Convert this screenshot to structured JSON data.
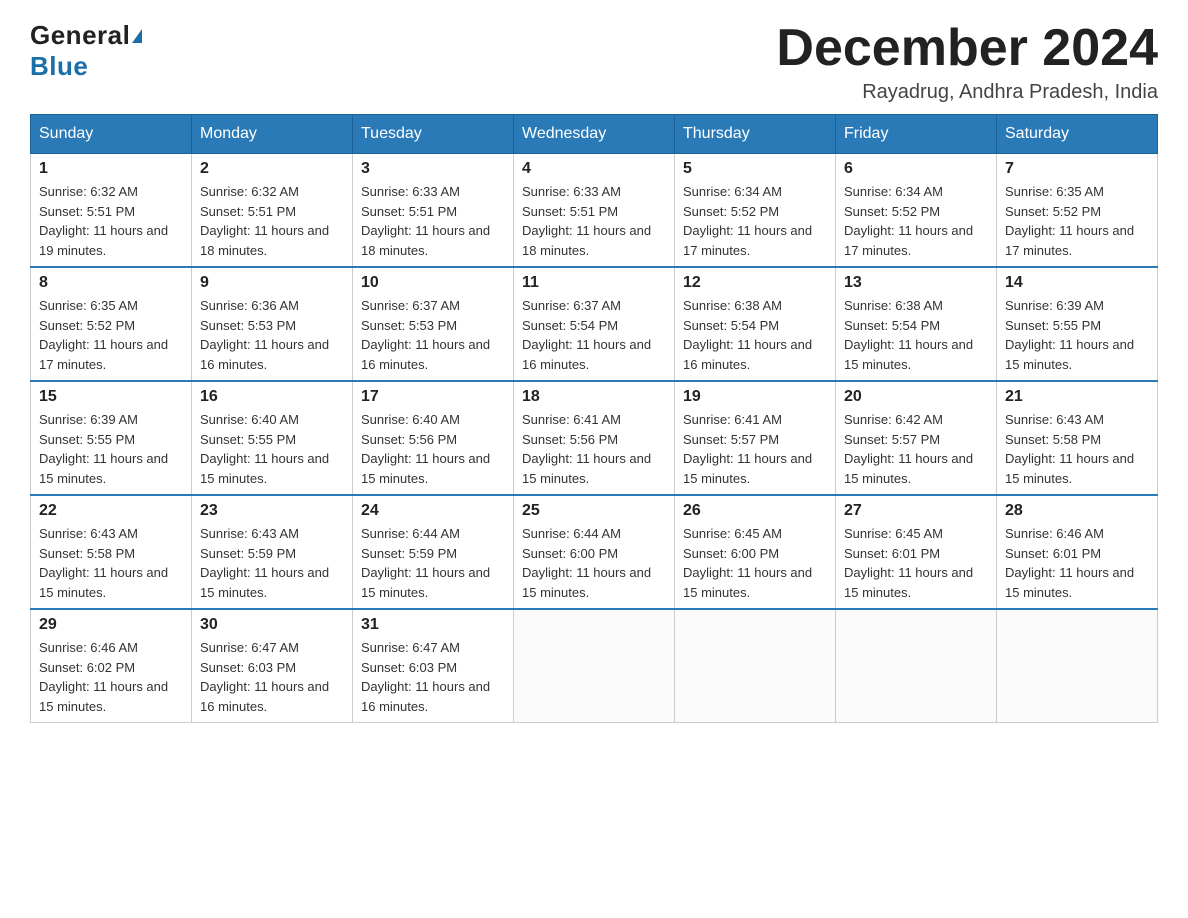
{
  "header": {
    "logo_general": "General",
    "logo_blue": "Blue",
    "title": "December 2024",
    "subtitle": "Rayadrug, Andhra Pradesh, India"
  },
  "weekdays": [
    "Sunday",
    "Monday",
    "Tuesday",
    "Wednesday",
    "Thursday",
    "Friday",
    "Saturday"
  ],
  "weeks": [
    [
      {
        "day": "1",
        "sunrise": "6:32 AM",
        "sunset": "5:51 PM",
        "daylight": "11 hours and 19 minutes."
      },
      {
        "day": "2",
        "sunrise": "6:32 AM",
        "sunset": "5:51 PM",
        "daylight": "11 hours and 18 minutes."
      },
      {
        "day": "3",
        "sunrise": "6:33 AM",
        "sunset": "5:51 PM",
        "daylight": "11 hours and 18 minutes."
      },
      {
        "day": "4",
        "sunrise": "6:33 AM",
        "sunset": "5:51 PM",
        "daylight": "11 hours and 18 minutes."
      },
      {
        "day": "5",
        "sunrise": "6:34 AM",
        "sunset": "5:52 PM",
        "daylight": "11 hours and 17 minutes."
      },
      {
        "day": "6",
        "sunrise": "6:34 AM",
        "sunset": "5:52 PM",
        "daylight": "11 hours and 17 minutes."
      },
      {
        "day": "7",
        "sunrise": "6:35 AM",
        "sunset": "5:52 PM",
        "daylight": "11 hours and 17 minutes."
      }
    ],
    [
      {
        "day": "8",
        "sunrise": "6:35 AM",
        "sunset": "5:52 PM",
        "daylight": "11 hours and 17 minutes."
      },
      {
        "day": "9",
        "sunrise": "6:36 AM",
        "sunset": "5:53 PM",
        "daylight": "11 hours and 16 minutes."
      },
      {
        "day": "10",
        "sunrise": "6:37 AM",
        "sunset": "5:53 PM",
        "daylight": "11 hours and 16 minutes."
      },
      {
        "day": "11",
        "sunrise": "6:37 AM",
        "sunset": "5:54 PM",
        "daylight": "11 hours and 16 minutes."
      },
      {
        "day": "12",
        "sunrise": "6:38 AM",
        "sunset": "5:54 PM",
        "daylight": "11 hours and 16 minutes."
      },
      {
        "day": "13",
        "sunrise": "6:38 AM",
        "sunset": "5:54 PM",
        "daylight": "11 hours and 15 minutes."
      },
      {
        "day": "14",
        "sunrise": "6:39 AM",
        "sunset": "5:55 PM",
        "daylight": "11 hours and 15 minutes."
      }
    ],
    [
      {
        "day": "15",
        "sunrise": "6:39 AM",
        "sunset": "5:55 PM",
        "daylight": "11 hours and 15 minutes."
      },
      {
        "day": "16",
        "sunrise": "6:40 AM",
        "sunset": "5:55 PM",
        "daylight": "11 hours and 15 minutes."
      },
      {
        "day": "17",
        "sunrise": "6:40 AM",
        "sunset": "5:56 PM",
        "daylight": "11 hours and 15 minutes."
      },
      {
        "day": "18",
        "sunrise": "6:41 AM",
        "sunset": "5:56 PM",
        "daylight": "11 hours and 15 minutes."
      },
      {
        "day": "19",
        "sunrise": "6:41 AM",
        "sunset": "5:57 PM",
        "daylight": "11 hours and 15 minutes."
      },
      {
        "day": "20",
        "sunrise": "6:42 AM",
        "sunset": "5:57 PM",
        "daylight": "11 hours and 15 minutes."
      },
      {
        "day": "21",
        "sunrise": "6:43 AM",
        "sunset": "5:58 PM",
        "daylight": "11 hours and 15 minutes."
      }
    ],
    [
      {
        "day": "22",
        "sunrise": "6:43 AM",
        "sunset": "5:58 PM",
        "daylight": "11 hours and 15 minutes."
      },
      {
        "day": "23",
        "sunrise": "6:43 AM",
        "sunset": "5:59 PM",
        "daylight": "11 hours and 15 minutes."
      },
      {
        "day": "24",
        "sunrise": "6:44 AM",
        "sunset": "5:59 PM",
        "daylight": "11 hours and 15 minutes."
      },
      {
        "day": "25",
        "sunrise": "6:44 AM",
        "sunset": "6:00 PM",
        "daylight": "11 hours and 15 minutes."
      },
      {
        "day": "26",
        "sunrise": "6:45 AM",
        "sunset": "6:00 PM",
        "daylight": "11 hours and 15 minutes."
      },
      {
        "day": "27",
        "sunrise": "6:45 AM",
        "sunset": "6:01 PM",
        "daylight": "11 hours and 15 minutes."
      },
      {
        "day": "28",
        "sunrise": "6:46 AM",
        "sunset": "6:01 PM",
        "daylight": "11 hours and 15 minutes."
      }
    ],
    [
      {
        "day": "29",
        "sunrise": "6:46 AM",
        "sunset": "6:02 PM",
        "daylight": "11 hours and 15 minutes."
      },
      {
        "day": "30",
        "sunrise": "6:47 AM",
        "sunset": "6:03 PM",
        "daylight": "11 hours and 16 minutes."
      },
      {
        "day": "31",
        "sunrise": "6:47 AM",
        "sunset": "6:03 PM",
        "daylight": "11 hours and 16 minutes."
      },
      null,
      null,
      null,
      null
    ]
  ]
}
